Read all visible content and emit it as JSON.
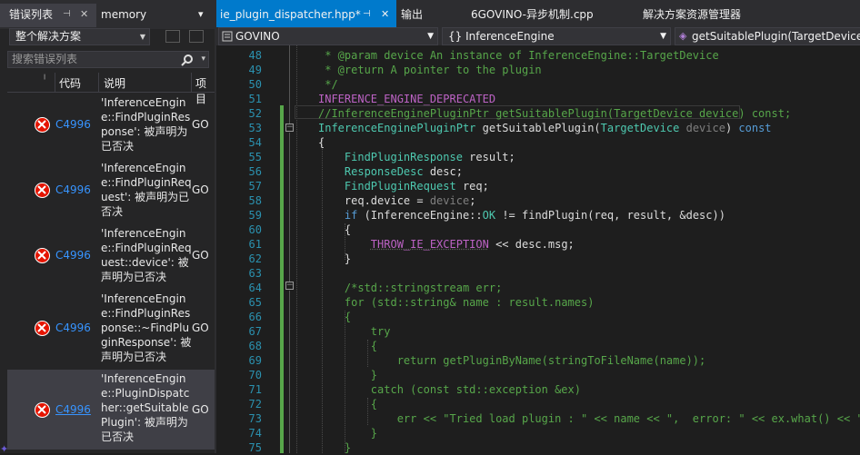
{
  "left_panel": {
    "tabs": [
      {
        "label": "错误列表"
      },
      {
        "label": "memory"
      }
    ],
    "pin_glyph": "⊣",
    "close_glyph": "✕",
    "dropdown_glyph": "▾",
    "scope_selector": {
      "value": "整个解决方案"
    },
    "search": {
      "placeholder": "搜索错误列表"
    },
    "columns": {
      "code": "代码",
      "desc": "说明",
      "proj": "项目"
    },
    "errors": [
      {
        "code": "C4996",
        "desc": "'InferenceEngine::FindPluginResponse': 被声明为已否决",
        "proj": "GO"
      },
      {
        "code": "C4996",
        "desc": "'InferenceEngine::FindPluginRequest': 被声明为已否决",
        "proj": "GO"
      },
      {
        "code": "C4996",
        "desc": "'InferenceEngine::FindPluginRequest::device': 被声明为已否决",
        "proj": "GO"
      },
      {
        "code": "C4996",
        "desc": "'InferenceEngine::FindPluginResponse::~FindPluginResponse': 被声明为已否决",
        "proj": "GO"
      },
      {
        "code": "C4996",
        "desc": "'InferenceEngine::PluginDispatcher::getSuitablePlugin': 被声明为已否决",
        "proj": "GO"
      }
    ]
  },
  "doc_tabs": [
    {
      "label": "ie_plugin_dispatcher.hpp*",
      "active": true
    },
    {
      "label": "输出"
    },
    {
      "label": "6GOVINO-异步机制.cpp"
    },
    {
      "label": "解决方案资源管理器"
    }
  ],
  "navbar": {
    "project": "GOVINO",
    "scope": "{} InferenceEngine",
    "member": "getSuitablePlugin(TargetDevice"
  },
  "editor": {
    "line_numbers": [
      "48",
      "49",
      "50",
      "51",
      "52",
      "53",
      "54",
      "55",
      "56",
      "57",
      "58",
      "59",
      "60",
      "61",
      "62",
      "63",
      "64",
      "65",
      "66",
      "67",
      "68",
      "69",
      "70",
      "71",
      "72",
      "73",
      "74",
      "75"
    ]
  },
  "colors": {
    "accent": "#007acc",
    "error": "#e51400",
    "link": "#3794ff",
    "line_number": "#2b91af",
    "comment": "#57a64a",
    "keyword": "#569cd6",
    "type": "#4ec9b0",
    "macro": "#bd63c5",
    "change_bar": "#57a64a"
  }
}
